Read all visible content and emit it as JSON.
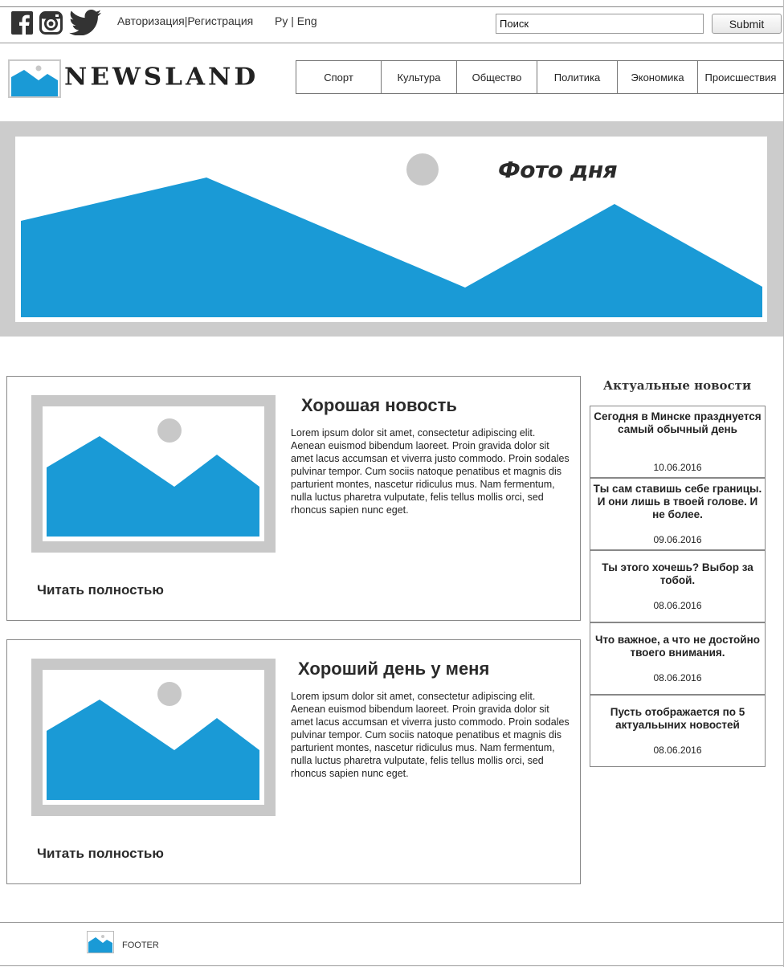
{
  "header": {
    "auth": {
      "login": "Авторизация",
      "separator": "|",
      "register": "Регистрация"
    },
    "lang": {
      "ru": "Ру",
      "separator": " | ",
      "en": "Eng"
    },
    "search": {
      "value": "Поиск",
      "submit_label": "Submit"
    },
    "social_icons": [
      "facebook-icon",
      "instagram-icon",
      "twitter-icon"
    ]
  },
  "brand": {
    "logo_text": "NEWSLAND"
  },
  "nav": {
    "items": [
      {
        "label": "Спорт"
      },
      {
        "label": "Культура"
      },
      {
        "label": "Общество"
      },
      {
        "label": "Политика"
      },
      {
        "label": "Экономика"
      },
      {
        "label": "Происшествия"
      }
    ]
  },
  "hero": {
    "title": "Фото дня"
  },
  "articles": [
    {
      "title": "Хорошая новость",
      "text": "Lorem ipsum dolor sit amet, consectetur adipiscing elit. Aenean euismod bibendum laoreet. Proin gravida dolor sit amet lacus accumsan et viverra justo commodo. Proin sodales pulvinar tempor. Cum sociis natoque penatibus et magnis dis parturient montes, nascetur ridiculus mus. Nam fermentum, nulla luctus pharetra vulputate, felis tellus mollis orci, sed rhoncus sapien nunc eget.",
      "read_more": "Читать полностью"
    },
    {
      "title": "Хороший день у меня",
      "text": "Lorem ipsum dolor sit amet, consectetur adipiscing elit. Aenean euismod bibendum laoreet. Proin gravida dolor sit amet lacus accumsan et viverra justo commodo. Proin sodales pulvinar tempor. Cum sociis natoque penatibus et magnis dis parturient montes, nascetur ridiculus mus. Nam fermentum, nulla luctus pharetra vulputate, felis tellus mollis orci, sed rhoncus sapien nunc eget.",
      "read_more": "Читать полностью"
    }
  ],
  "sidebar": {
    "title": "Актуальные новости",
    "items": [
      {
        "title": "Сегодня в Минске празднуется самый обычный день",
        "date": "10.06.2016"
      },
      {
        "title": "Ты сам ставишь себе границы. И они лишь в твоей голове. И не более.",
        "date": "09.06.2016"
      },
      {
        "title": "Ты этого хочешь? Выбор за тобой.",
        "date": "08.06.2016"
      },
      {
        "title": "Что важное, а что не достойно твоего внимания.",
        "date": "08.06.2016"
      },
      {
        "title": "Пусть отображается по 5 актуальыних новостей",
        "date": "08.06.2016"
      }
    ]
  },
  "footer": {
    "text": "FOOTER"
  },
  "colors": {
    "accent_blue": "#1a9ad6",
    "placeholder_gray": "#cccccc",
    "sun_gray": "#c8c8c8"
  }
}
